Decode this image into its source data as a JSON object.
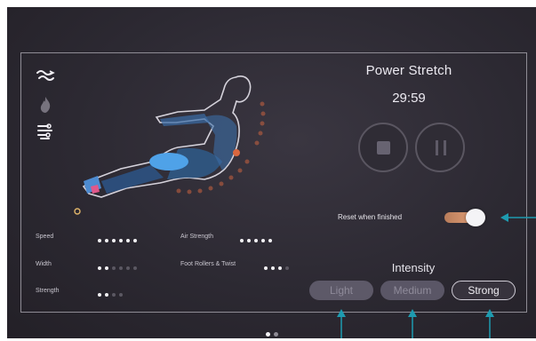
{
  "sidebar": {
    "icons": [
      {
        "name": "massage-wave-icon"
      },
      {
        "name": "heat-flame-icon"
      },
      {
        "name": "air-compression-icon"
      }
    ]
  },
  "program": {
    "title": "Power Stretch",
    "timer": "29:59"
  },
  "controls": {
    "stop_icon": "stop-icon",
    "pause_icon": "pause-icon"
  },
  "reset_toggle": {
    "label": "Reset when finished",
    "on": true,
    "accent": "#e8a57d"
  },
  "intensity": {
    "title": "Intensity",
    "options": [
      {
        "label": "Light",
        "selected": false
      },
      {
        "label": "Medium",
        "selected": false
      },
      {
        "label": "Strong",
        "selected": true
      }
    ]
  },
  "settings": {
    "left": [
      {
        "label": "Speed",
        "level": 6,
        "max": 6
      },
      {
        "label": "Width",
        "level": 2,
        "max": 6
      },
      {
        "label": "Strength",
        "level": 2,
        "max": 4
      }
    ],
    "right": [
      {
        "label": "Air Strength",
        "level": 5,
        "max": 5
      },
      {
        "label": "Foot Rollers & Twist",
        "level": 3,
        "max": 4
      }
    ]
  },
  "pagination": {
    "current": 1,
    "total": 2
  },
  "colors": {
    "annotation_arrow": "#1e9bb0",
    "progress_dot": "#d9673f"
  }
}
